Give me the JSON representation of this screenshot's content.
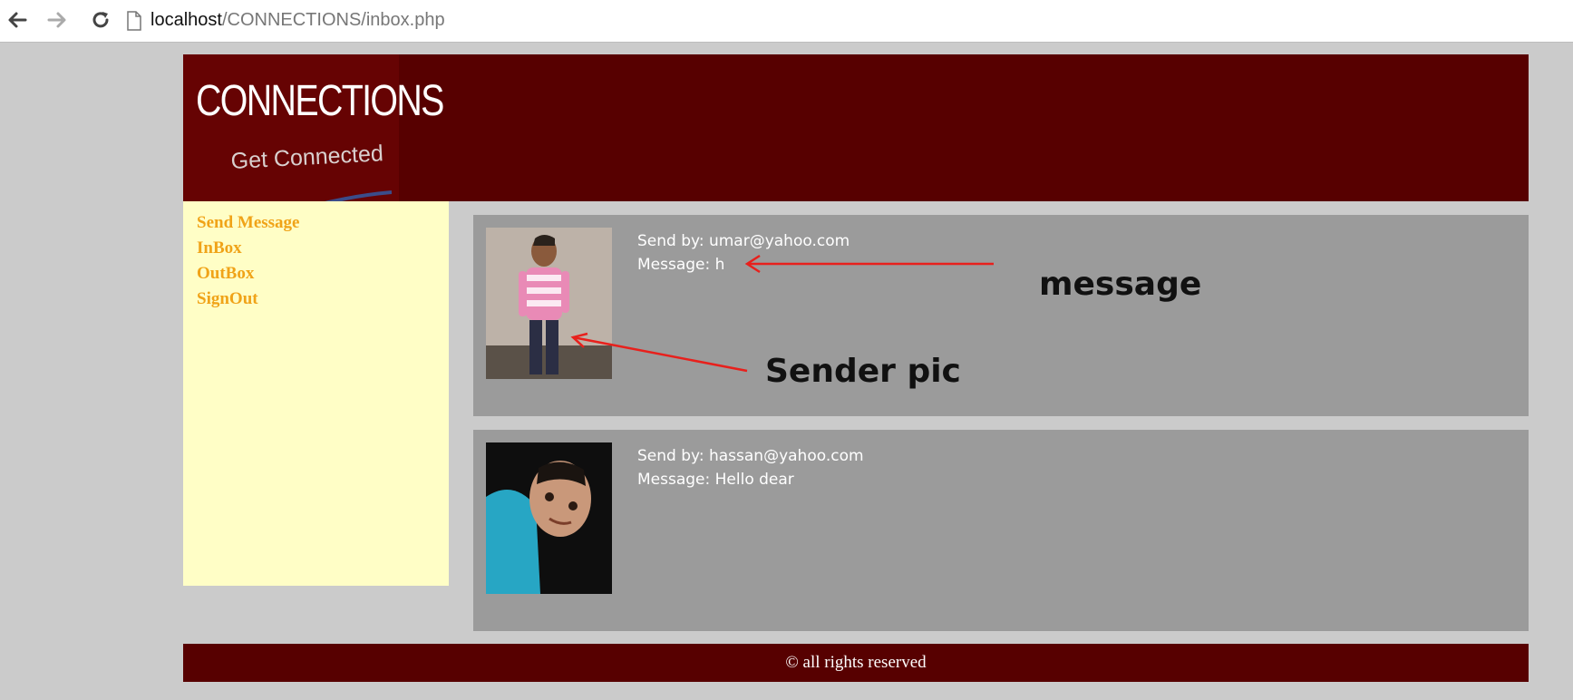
{
  "browser": {
    "url_host": "localhost",
    "url_path": "/CONNECTIONS/inbox.php"
  },
  "header": {
    "logo_title": "CONNECTIONS",
    "logo_subtitle": "Get Connected"
  },
  "sidebar": {
    "items": [
      {
        "label": "Send Message"
      },
      {
        "label": "InBox"
      },
      {
        "label": "OutBox"
      },
      {
        "label": "SignOut"
      }
    ]
  },
  "messages": [
    {
      "sender": "Send by: umar@yahoo.com",
      "message": "Message: h"
    },
    {
      "sender": "Send by: hassan@yahoo.com",
      "message": "Message: Hello dear"
    }
  ],
  "annotations": {
    "message_label": "message",
    "sender_pic_label": "Sender pic"
  },
  "footer": {
    "text": "© all rights reserved"
  },
  "colors": {
    "header_bg": "#570000",
    "sidebar_bg": "#fffec6",
    "link_color": "#f0a318",
    "card_bg": "#9b9b9b",
    "page_bg": "#cbcbcb",
    "arrow_color": "#e8201c"
  },
  "icons": [
    "back-arrow-icon",
    "forward-arrow-icon",
    "reload-icon",
    "page-icon"
  ]
}
